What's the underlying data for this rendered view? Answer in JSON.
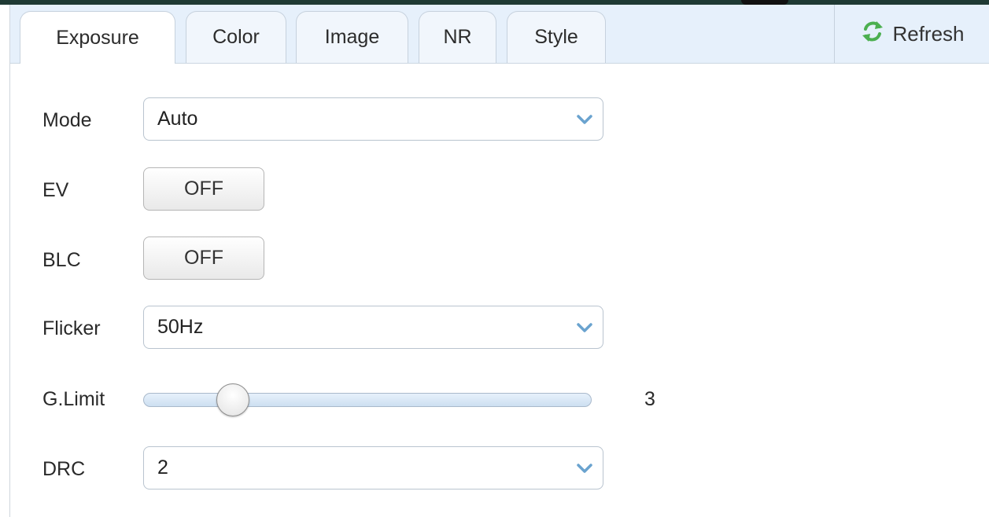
{
  "tabs": [
    {
      "label": "Exposure",
      "active": true
    },
    {
      "label": "Color",
      "active": false
    },
    {
      "label": "Image",
      "active": false
    },
    {
      "label": "NR",
      "active": false
    },
    {
      "label": "Style",
      "active": false
    }
  ],
  "refresh": {
    "label": "Refresh",
    "icon": "refresh-icon"
  },
  "form": {
    "mode": {
      "label": "Mode",
      "value": "Auto"
    },
    "ev": {
      "label": "EV",
      "value": "OFF"
    },
    "blc": {
      "label": "BLC",
      "value": "OFF"
    },
    "flicker": {
      "label": "Flicker",
      "value": "50Hz"
    },
    "glimit": {
      "label": "G.Limit",
      "value": "3",
      "slider_fraction": 0.2
    },
    "drc": {
      "label": "DRC",
      "value": "2"
    }
  },
  "colors": {
    "tabbar_bg": "#e6f0fb",
    "border": "#c6d1dd",
    "chevron": "#6aa3cf",
    "refresh_icon": "#4caf50"
  }
}
